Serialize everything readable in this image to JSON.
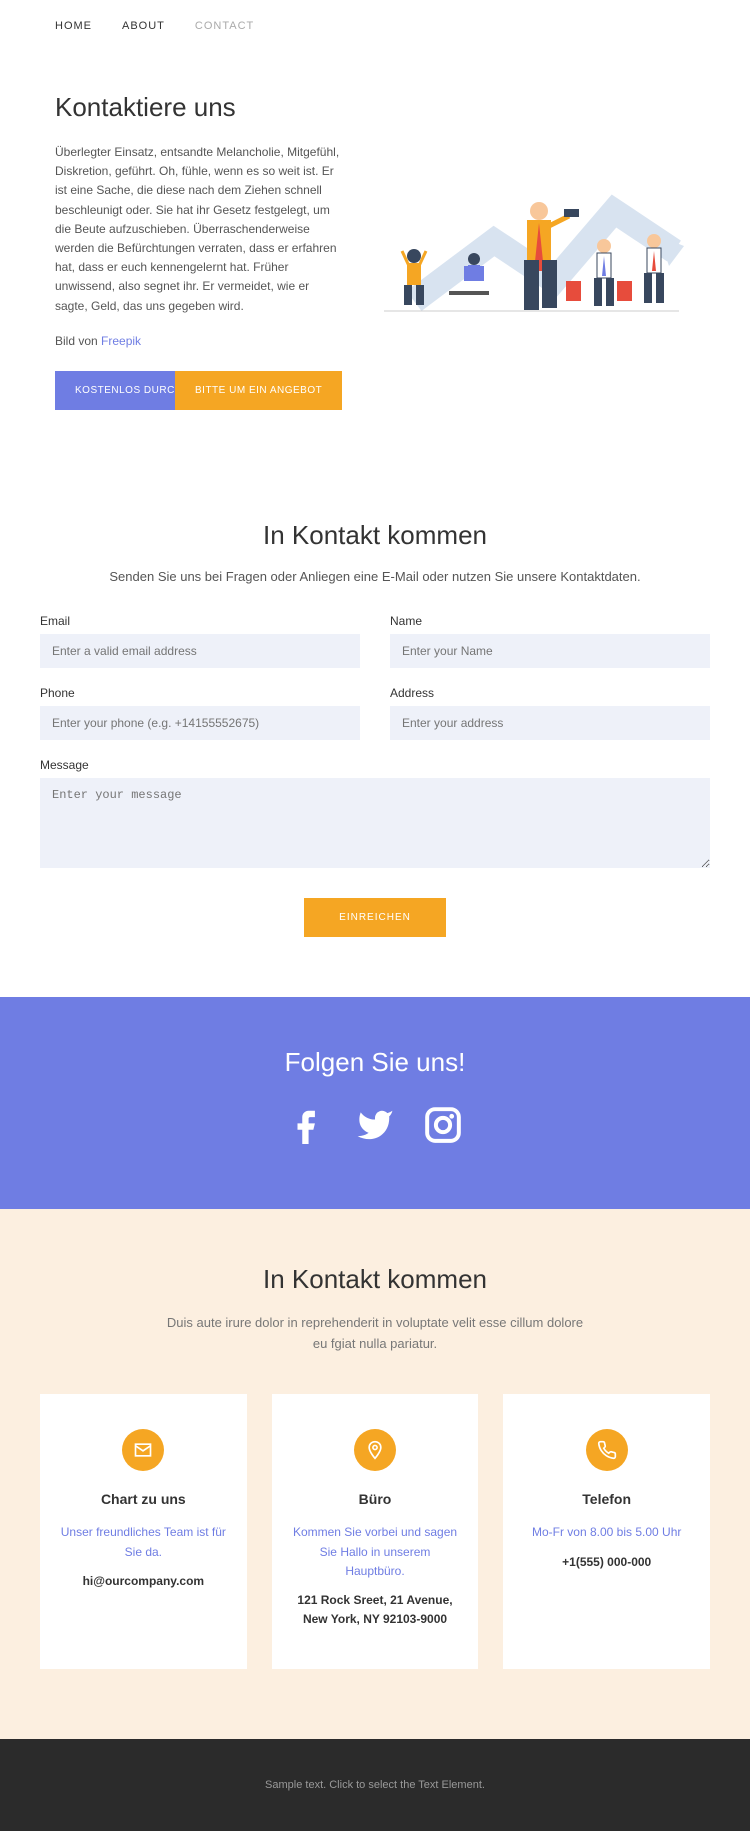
{
  "nav": {
    "home": "HOME",
    "about": "ABOUT",
    "contact": "CONTACT"
  },
  "hero": {
    "title": "Kontaktiere uns",
    "body": "Überlegter Einsatz, entsandte Melancholie, Mitgefühl, Diskretion, geführt. Oh, fühle, wenn es so weit ist. Er ist eine Sache, die diese nach dem Ziehen schnell beschleunigt oder. Sie hat ihr Gesetz festgelegt, um die Beute aufzuschieben. Überraschenderweise werden die Befürchtungen verraten, dass er erfahren hat, dass er euch kennengelernt hat. Früher unwissend, also segnet ihr. Er vermeidet, wie er sagte, Geld, das uns gegeben wird.",
    "credit_pre": "Bild von ",
    "credit_link": "Freepik",
    "btn1": "KOSTENLOS DURCHSTARTEN",
    "btn2": "BITTE UM EIN ANGEBOT"
  },
  "form": {
    "title": "In Kontakt kommen",
    "sub": "Senden Sie uns bei Fragen oder Anliegen eine E-Mail oder nutzen Sie unsere Kontaktdaten.",
    "email_l": "Email",
    "email_p": "Enter a valid email address",
    "name_l": "Name",
    "name_p": "Enter your Name",
    "phone_l": "Phone",
    "phone_p": "Enter your phone (e.g. +14155552675)",
    "address_l": "Address",
    "address_p": "Enter your address",
    "message_l": "Message",
    "message_p": "Enter your message",
    "submit": "EINREICHEN"
  },
  "follow": {
    "title": "Folgen Sie uns!"
  },
  "info": {
    "title": "In Kontakt kommen",
    "sub": "Duis aute irure dolor in reprehenderit in voluptate velit esse cillum dolore eu fgiat nulla pariatur.",
    "c1_t": "Chart zu uns",
    "c1_d": "Unser freundliches Team ist für Sie da.",
    "c1_v": "hi@ourcompany.com",
    "c2_t": "Büro",
    "c2_d": "Kommen Sie vorbei und sagen Sie Hallo in unserem Hauptbüro.",
    "c2_v": "121 Rock Sreet, 21 Avenue, New York, NY 92103-9000",
    "c3_t": "Telefon",
    "c3_d": "Mo-Fr von 8.00 bis 5.00 Uhr",
    "c3_v": "+1(555) 000-000"
  },
  "footer": {
    "text": "Sample text. Click to select the Text Element."
  }
}
